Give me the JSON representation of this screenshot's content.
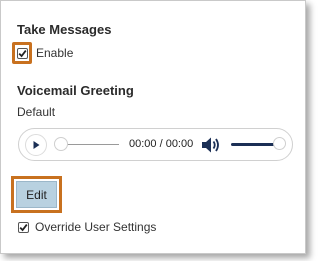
{
  "take_messages": {
    "title": "Take Messages",
    "enable_label": "Enable",
    "enable_checked": true
  },
  "voicemail_greeting": {
    "title": "Voicemail Greeting",
    "greeting_value": "Default",
    "player": {
      "time_display": "00:00 / 00:00",
      "play_icon": "play-icon",
      "volume_icon": "volume-icon"
    },
    "edit_label": "Edit"
  },
  "override": {
    "label": "Override User Settings",
    "checked": true
  },
  "colors": {
    "highlight": "#c8711f",
    "edit_button": "#b8d1e0",
    "volume_fill": "#1b2f55"
  }
}
